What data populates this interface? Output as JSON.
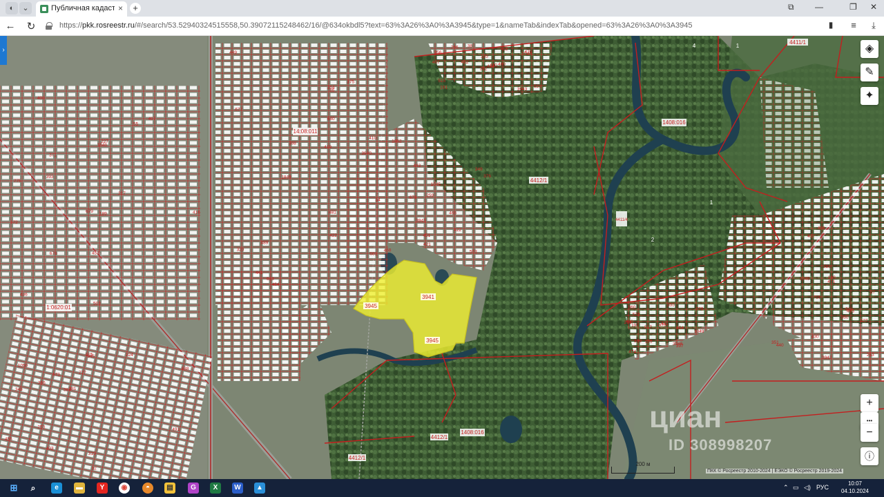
{
  "browser": {
    "tab_title": "Публичная кадастровая карта",
    "tab_close": "×",
    "new_tab": "+",
    "url_prefix": "https://",
    "url_domain": "pkk.rosreestr.ru",
    "url_rest": "/#/search/53.52940324515558,50.39072115248462/16/@634okbdl5?text=63%3A26%3A0%3A3945&type=1&nameTab&indexTab&opened=63%3A26%3A0%3A3945"
  },
  "map": {
    "highlighted_parcel_labels": [
      "3941",
      "3945",
      "3945"
    ],
    "quarter_labels": [
      "14:08:011",
      "1408:016",
      "1408:016",
      "1:0620:01"
    ],
    "road_label": "4412/1",
    "forest_labels": [
      "4412/1",
      "4412/1",
      "4412/1",
      "4411/4"
    ],
    "plot_numbers": [
      "189",
      "677",
      "678",
      "191",
      "190",
      "195",
      "224",
      "227",
      "254",
      "259",
      "266",
      "253",
      "192",
      "688",
      "679",
      "680",
      "681",
      "185",
      "283",
      "336",
      "381",
      "436",
      "441",
      "443",
      "480",
      "493",
      "524",
      "545",
      "775",
      "481",
      "376",
      "392",
      "430",
      "470",
      "473",
      "497",
      "489",
      "503",
      "521",
      "502",
      "355",
      "384",
      "393",
      "422",
      "460",
      "467",
      "471",
      "474",
      "315",
      "317",
      "320",
      "349",
      "356",
      "360",
      "397",
      "403",
      "408",
      "449",
      "451",
      "470",
      "496",
      "517",
      "343",
      "371",
      "375",
      "410",
      "418",
      "437",
      "441",
      "455",
      "457",
      "464",
      "466",
      "482",
      "351",
      "360",
      "366",
      "372",
      "398",
      "421",
      "430",
      "440",
      "454",
      "491",
      "503",
      "3940",
      "3941",
      "3943",
      "3942",
      "3946",
      "415",
      "416",
      "419",
      "422",
      "424",
      "427",
      "430",
      "32",
      "55",
      "36",
      "34",
      "38",
      "37",
      "251",
      "253",
      "676",
      "683",
      "1045",
      "1046",
      "1048",
      "1049",
      "1050",
      "1848",
      "1849",
      "1852",
      "515",
      "719",
      "779",
      "777"
    ],
    "river_labels": [
      "1",
      "2",
      "4",
      "1"
    ],
    "parcel_label_1": "4411/1",
    "scale_label": "200 м",
    "attribution": "ПКК © Росреестр 2010-2024 | ЕЭКО © Росреестр 2019-2024",
    "watermark": "циан",
    "watermark_id": "ID 308998207"
  },
  "controls": {
    "layers": "layers-icon",
    "ruler": "ruler-icon",
    "locate": "locate-icon",
    "zoom_in": "+",
    "zoom_dots": "•••",
    "zoom_out": "−",
    "info": "info-icon"
  },
  "taskbar": {
    "lang": "РУС",
    "time": "10:07",
    "date": "04.10.2024"
  }
}
